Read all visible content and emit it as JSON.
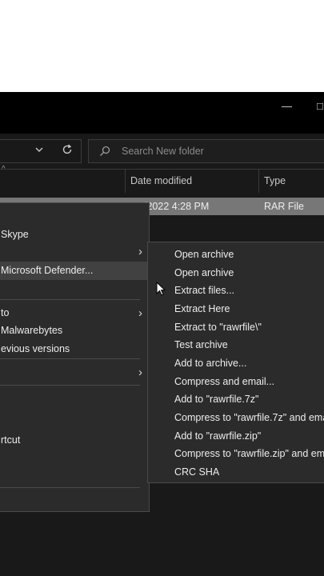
{
  "titlebar": {
    "minimize_glyph": "—",
    "maximize_glyph": "□"
  },
  "toolbar": {
    "search_placeholder": "Search New folder"
  },
  "columns": {
    "date_modified": "Date modified",
    "type": "Type"
  },
  "file_row": {
    "date": "/2022 4:28 PM",
    "type": "RAR File"
  },
  "context_menu": {
    "items": [
      {
        "label": "Skype"
      },
      {
        "label": ""
      },
      {
        "label": "Microsoft Defender..."
      },
      {
        "label": " to"
      },
      {
        "label": "Malwarebytes"
      },
      {
        "label": "evious versions"
      },
      {
        "label": ""
      },
      {
        "label": "rtcut"
      }
    ]
  },
  "submenu": {
    "items": [
      {
        "label": "Open archive"
      },
      {
        "label": "Open archive"
      },
      {
        "label": "Extract files..."
      },
      {
        "label": "Extract Here"
      },
      {
        "label": "Extract to \"rawrfile\\\""
      },
      {
        "label": "Test archive"
      },
      {
        "label": "Add to archive..."
      },
      {
        "label": "Compress and email..."
      },
      {
        "label": "Add to \"rawrfile.7z\""
      },
      {
        "label": "Compress to \"rawrfile.7z\" and ema"
      },
      {
        "label": "Add to \"rawrfile.zip\""
      },
      {
        "label": "Compress to \"rawrfile.zip\" and em"
      },
      {
        "label": "CRC SHA"
      }
    ]
  },
  "icons": {
    "search": "search-icon",
    "refresh": "refresh-icon",
    "chevron": "chevron-down-icon",
    "submenu_arrow": "chevron-right-icon",
    "cursor": "mouse-cursor-icon"
  },
  "colors": {
    "window_bg": "#191919",
    "menu_bg": "#2b2b2b",
    "selection": "#777777",
    "highlight": "#414141"
  }
}
